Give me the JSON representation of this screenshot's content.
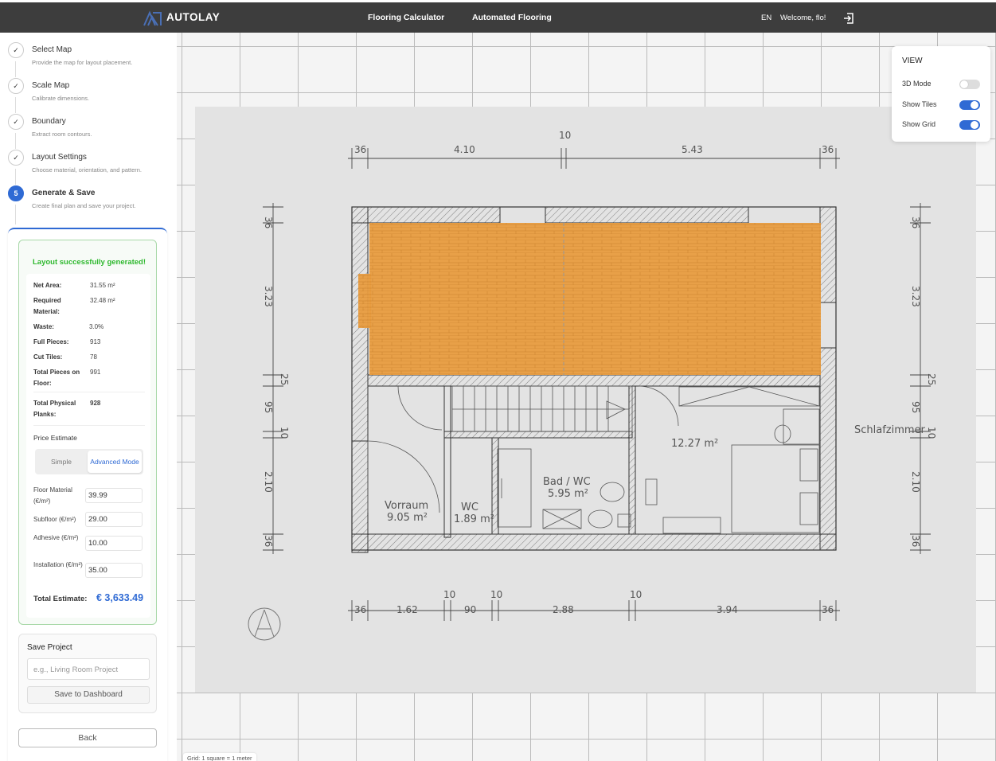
{
  "header": {
    "brand": "AUTOLAY",
    "nav": [
      "Flooring Calculator",
      "Automated Flooring"
    ],
    "lang": "EN",
    "welcome": "Welcome, flo!"
  },
  "steps": [
    {
      "num": "✓",
      "title": "Select Map",
      "desc": "Provide the map for layout placement."
    },
    {
      "num": "✓",
      "title": "Scale Map",
      "desc": "Calibrate dimensions."
    },
    {
      "num": "✓",
      "title": "Boundary",
      "desc": "Extract room contours."
    },
    {
      "num": "✓",
      "title": "Layout Settings",
      "desc": "Choose material, orientation, and pattern."
    },
    {
      "num": "5",
      "title": "Generate & Save",
      "desc": "Create final plan and save your project."
    }
  ],
  "result": {
    "success": "Layout successfully generated!",
    "stats": [
      {
        "label": "Net Area:",
        "value": "31.55 m²"
      },
      {
        "label": "Required Material:",
        "value": "32.48 m²"
      },
      {
        "label": "Waste:",
        "value": "3.0%"
      },
      {
        "label": "Full Pieces:",
        "value": "913"
      },
      {
        "label": "Cut Tiles:",
        "value": "78"
      },
      {
        "label": "Total Pieces on Floor:",
        "value": "991"
      },
      {
        "label": "Total Physical Planks:",
        "value": "928"
      }
    ],
    "price_title": "Price Estimate",
    "mode_simple": "Simple",
    "mode_advanced": "Advanced Mode",
    "inputs": [
      {
        "label": "Floor Material (€/m²)",
        "value": "39.99"
      },
      {
        "label": "Subfloor (€/m²)",
        "value": "29.00"
      },
      {
        "label": "Adhesive (€/m²)",
        "value": "10.00"
      },
      {
        "label": "Installation (€/m²)",
        "value": "35.00"
      }
    ],
    "total_label": "Total Estimate:",
    "total_value": "€ 3,633.49"
  },
  "save": {
    "title": "Save Project",
    "placeholder": "e.g., Living Room Project",
    "button": "Save to Dashboard"
  },
  "back": "Back",
  "view": {
    "title": "VIEW",
    "toggles": [
      {
        "label": "3D Mode",
        "on": false
      },
      {
        "label": "Show Tiles",
        "on": true
      },
      {
        "label": "Show Grid",
        "on": true
      }
    ]
  },
  "scale_text": "Grid: 1 square = 1 meter",
  "plan": {
    "top_dims": [
      "36",
      "4.10",
      "10",
      "5.43",
      "36"
    ],
    "bottom_dims": [
      "36",
      "1.62",
      "10",
      "90",
      "10",
      "2.88",
      "10",
      "3.94",
      "36"
    ],
    "side_dims": [
      "36",
      "3.23",
      "25",
      "95",
      "10",
      "2.10",
      "36"
    ],
    "rooms": [
      {
        "name": "Schlafzimmer",
        "area": "12.27 m²"
      },
      {
        "name": "Bad / WC",
        "area": "5.95 m²"
      },
      {
        "name": "Vorraum",
        "area": "9.05 m²"
      },
      {
        "name": "WC",
        "area": "1.89 m²"
      }
    ]
  }
}
